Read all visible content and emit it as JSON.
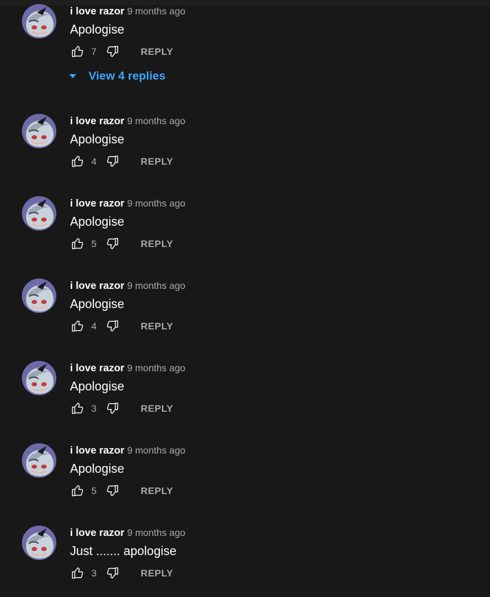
{
  "comments": [
    {
      "author": "i love razor",
      "time": "9 months ago",
      "text": "Apologise",
      "likes": "7",
      "reply_label": "REPLY",
      "view_replies": "View 4 replies"
    },
    {
      "author": "i love razor",
      "time": "9 months ago",
      "text": "Apologise",
      "likes": "4",
      "reply_label": "REPLY"
    },
    {
      "author": "i love razor",
      "time": "9 months ago",
      "text": "Apologise",
      "likes": "5",
      "reply_label": "REPLY"
    },
    {
      "author": "i love razor",
      "time": "9 months ago",
      "text": "Apologise",
      "likes": "4",
      "reply_label": "REPLY"
    },
    {
      "author": "i love razor",
      "time": "9 months ago",
      "text": "Apologise",
      "likes": "3",
      "reply_label": "REPLY"
    },
    {
      "author": "i love razor",
      "time": "9 months ago",
      "text": "Apologise",
      "likes": "5",
      "reply_label": "REPLY"
    },
    {
      "author": "i love razor",
      "time": "9 months ago",
      "text": "Just ....... apologise",
      "likes": "3",
      "reply_label": "REPLY"
    }
  ],
  "colors": {
    "background": "#181818",
    "link": "#3ea6ff",
    "secondary_text": "#aaaaaa"
  },
  "icons": {
    "like": "thumb-up-outline-icon",
    "dislike": "thumb-down-outline-icon",
    "expand": "caret-down-icon"
  }
}
